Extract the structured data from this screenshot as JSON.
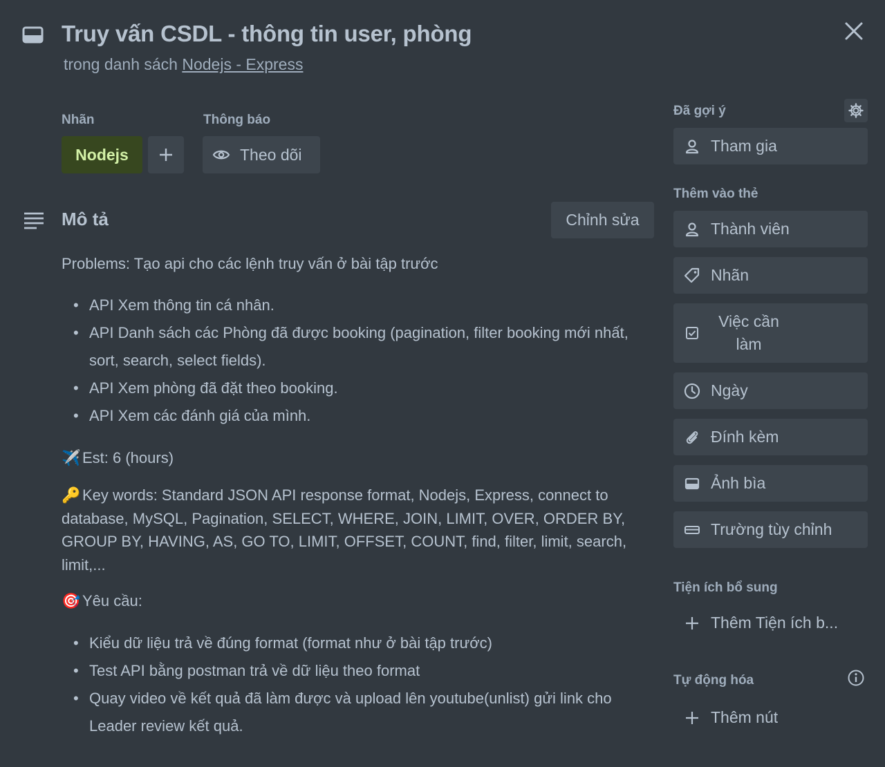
{
  "header": {
    "title": "Truy vấn CSDL - thông tin user, phòng",
    "subtitle_prefix": "trong danh sách ",
    "list_name": "Nodejs - Express"
  },
  "labels_section": {
    "heading": "Nhãn",
    "label_text": "Nodejs",
    "label_color": "#37471f"
  },
  "notifications_section": {
    "heading": "Thông báo",
    "follow_label": "Theo dõi"
  },
  "description": {
    "heading": "Mô tả",
    "edit_label": "Chỉnh sửa",
    "problems": "Problems: Tạo api cho các lệnh truy vấn ở bài tập trước",
    "problem_items": [
      "API Xem thông tin cá nhân.",
      "API Danh sách các Phòng đã được booking (pagination, filter booking mới nhất, sort, search, select fields).",
      "API Xem phòng đã đặt theo booking.",
      "API Xem các đánh giá của mình."
    ],
    "est_emoji": "✈️",
    "est_text": "Est: 6 (hours)",
    "key_emoji": "🔑",
    "key_text": "Key words: Standard JSON API response format, Nodejs, Express, connect to database, MySQL, Pagination, SELECT, WHERE, JOIN, LIMIT, OVER, ORDER BY, GROUP BY, HAVING, AS, GO TO, LIMIT, OFFSET, COUNT, find, filter, limit, search, limit,...",
    "req_emoji": "🎯",
    "req_text": "Yêu cầu:",
    "req_items": [
      "Kiểu dữ liệu trả về đúng format (format như ở bài tập trước)",
      "Test API bằng postman trả về dữ liệu theo format",
      "Quay video về kết quả đã làm được và upload lên youtube(unlist) gửi link cho Leader review kết quả."
    ]
  },
  "sidebar": {
    "suggested_heading": "Đã gợi ý",
    "join_label": "Tham gia",
    "add_to_card_heading": "Thêm vào thẻ",
    "members_label": "Thành viên",
    "labels_label": "Nhãn",
    "checklist_label": "Việc cần làm",
    "dates_label": "Ngày",
    "attachment_label": "Đính kèm",
    "cover_label": "Ảnh bìa",
    "custom_fields_label": "Trường tùy chỉnh",
    "powerups_heading": "Tiện ích bổ sung",
    "add_powerup_label": "Thêm Tiện ích b...",
    "automation_heading": "Tự động hóa",
    "add_button_label": "Thêm nút"
  },
  "colors": {
    "background": "#323940",
    "button": "#3d454d",
    "text": "#b6c2cf",
    "label_text": "#d3f1a7"
  },
  "icons": [
    "card-icon",
    "close-icon",
    "plus-icon",
    "eye-icon",
    "description-icon",
    "gear-icon",
    "person-icon",
    "tag-icon",
    "checkbox-icon",
    "clock-icon",
    "paperclip-icon",
    "cover-icon",
    "custom-field-icon",
    "info-icon"
  ]
}
